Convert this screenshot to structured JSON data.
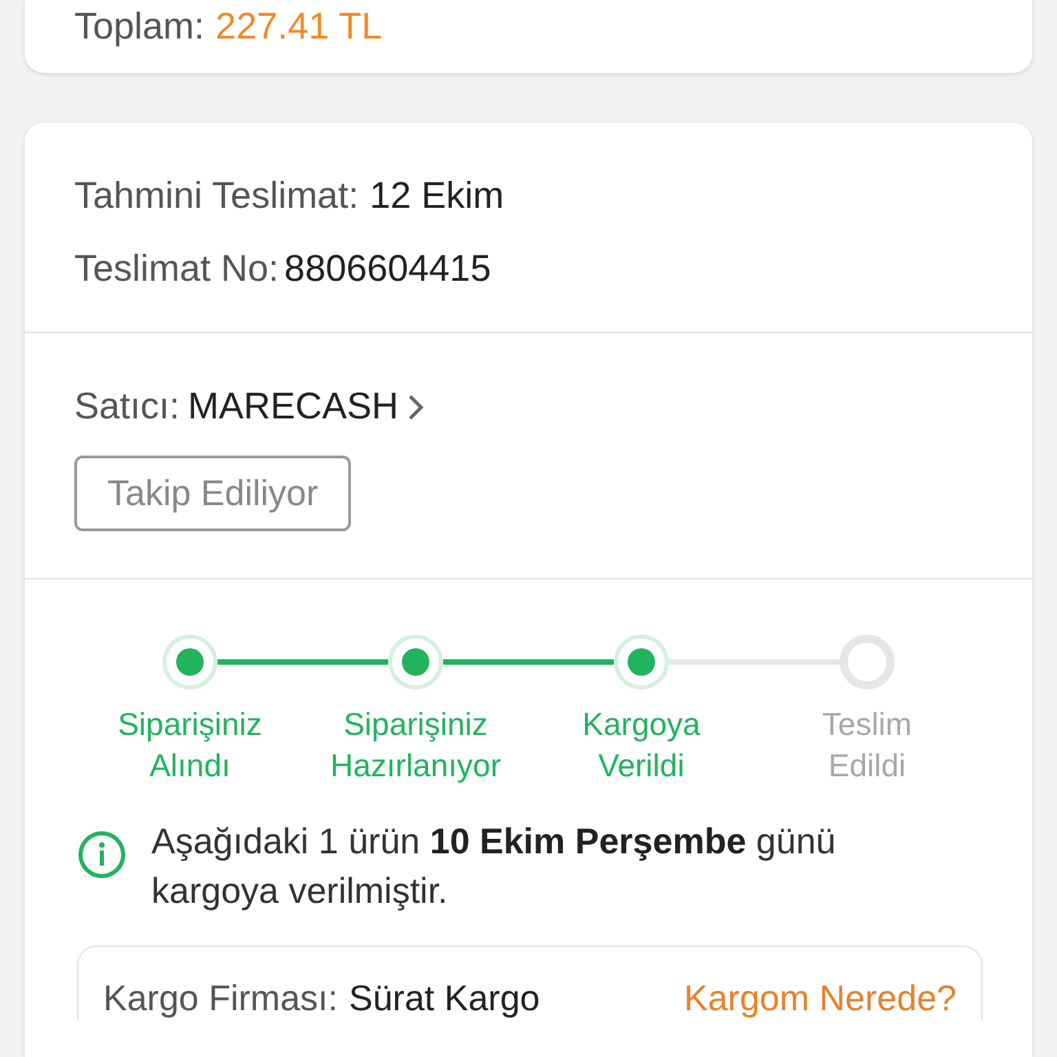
{
  "summary": {
    "total_label": "Toplam:",
    "total_value": "227.41 TL"
  },
  "delivery": {
    "estimate_label": "Tahmini Teslimat:",
    "estimate_value": "12 Ekim",
    "number_label": "Teslimat No:",
    "number_value": "8806604415"
  },
  "seller": {
    "label": "Satıcı:",
    "name": "MARECASH",
    "follow_button": "Takip Ediliyor"
  },
  "steps": [
    {
      "label": "Siparişiniz Alındı",
      "done": true
    },
    {
      "label": "Siparişiniz Hazırlanıyor",
      "done": true
    },
    {
      "label": "Kargoya Verildi",
      "done": true
    },
    {
      "label": "Teslim Edildi",
      "done": false
    }
  ],
  "info": "Aşağıdaki 1 ürün **10 Ekim Perşembe** günü kargoya verilmiştir.",
  "cargo": {
    "label": "Kargo Firması:",
    "name": "Sürat Kargo",
    "link": "Kargom Nerede?"
  }
}
